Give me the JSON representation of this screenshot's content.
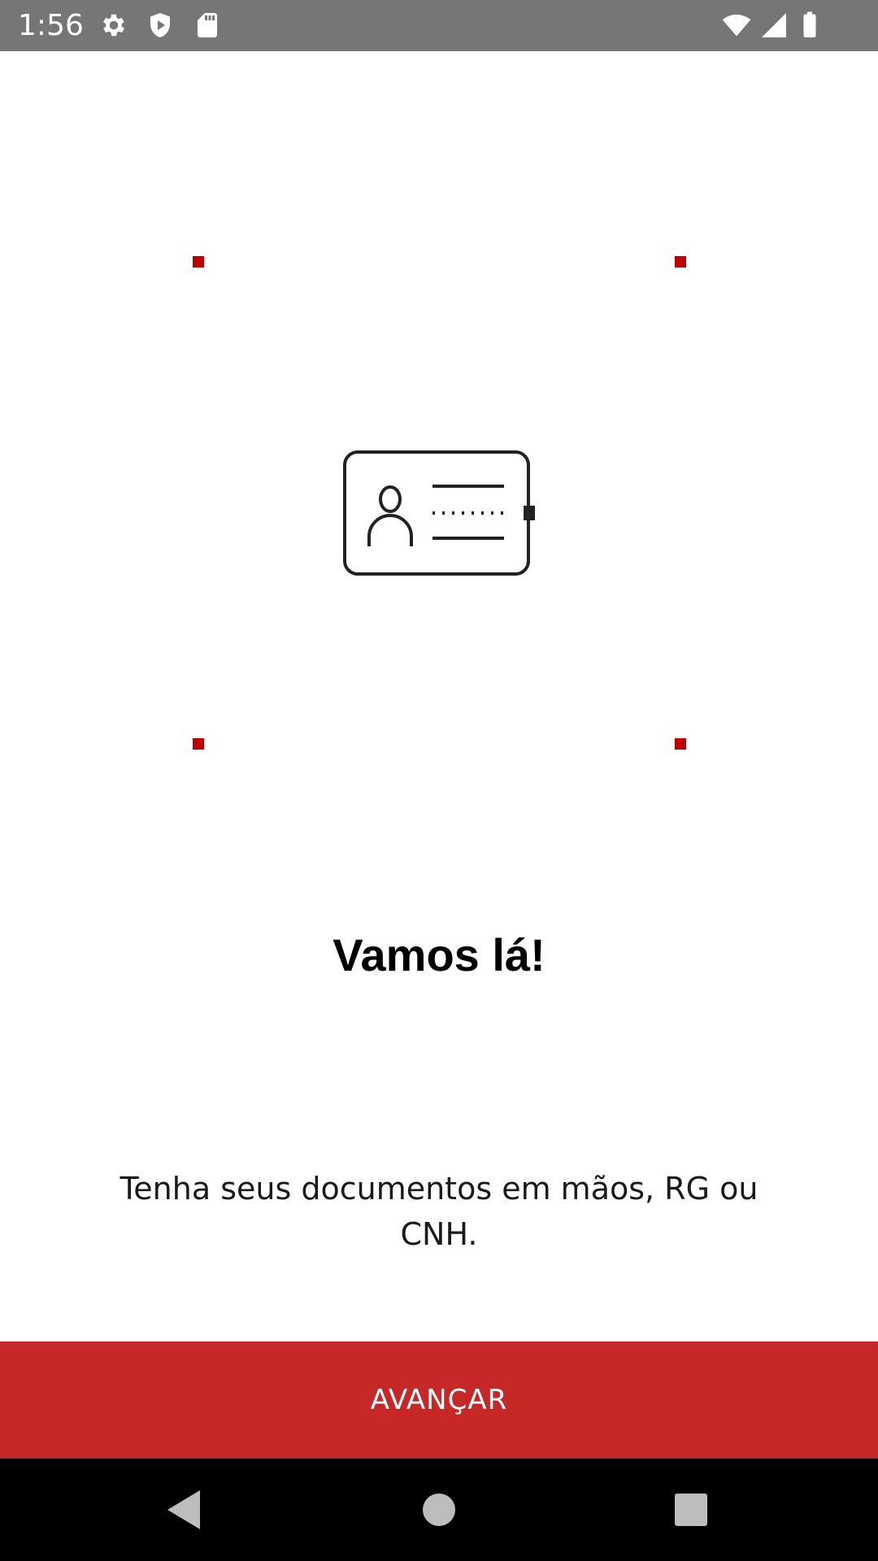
{
  "status_bar": {
    "time": "1:56",
    "left_icons": [
      "gear-icon",
      "shield-icon",
      "sd-card-icon"
    ],
    "right_icons": [
      "wifi-icon",
      "signal-icon",
      "battery-icon"
    ],
    "background_color": "#767676"
  },
  "illustration": {
    "icon": "id-card-icon",
    "frame_corner_color": "#c00000"
  },
  "content": {
    "title": "Vamos lá!",
    "message": "Tenha seus documentos em mãos, RG ou CNH."
  },
  "actions": {
    "advance_label": "AVANÇAR",
    "button_color": "#c62828"
  },
  "nav_bar": {
    "buttons": [
      "back-icon",
      "home-icon",
      "recents-icon"
    ]
  }
}
